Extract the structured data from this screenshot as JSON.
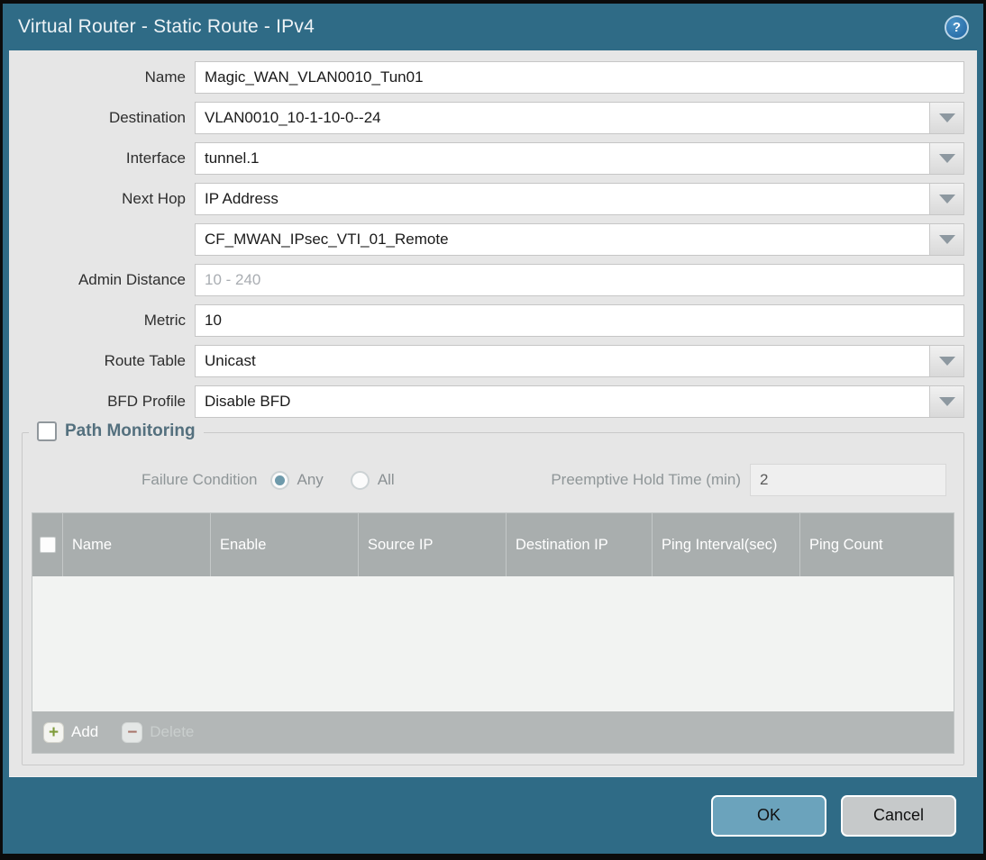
{
  "dialog": {
    "title": "Virtual Router - Static Route - IPv4"
  },
  "icons": {
    "help": "?",
    "dropdown": "triangle-down",
    "add": "+",
    "delete": "−"
  },
  "form": {
    "name": {
      "label": "Name",
      "value": "Magic_WAN_VLAN0010_Tun01"
    },
    "destination": {
      "label": "Destination",
      "value": "VLAN0010_10-1-10-0--24"
    },
    "interface": {
      "label": "Interface",
      "value": "tunnel.1"
    },
    "next_hop": {
      "label": "Next Hop",
      "value": "IP Address"
    },
    "next_hop_address": {
      "value": "CF_MWAN_IPsec_VTI_01_Remote"
    },
    "admin_distance": {
      "label": "Admin Distance",
      "value": "",
      "placeholder": "10 - 240"
    },
    "metric": {
      "label": "Metric",
      "value": "10"
    },
    "route_table": {
      "label": "Route Table",
      "value": "Unicast"
    },
    "bfd_profile": {
      "label": "BFD Profile",
      "value": "Disable BFD"
    }
  },
  "path_monitoring": {
    "title": "Path Monitoring",
    "enabled": false,
    "failure_condition_label": "Failure Condition",
    "options": {
      "any": "Any",
      "all": "All",
      "selected": "Any"
    },
    "preemptive_hold_time": {
      "label": "Preemptive Hold Time (min)",
      "value": "2"
    },
    "table": {
      "columns": [
        "Name",
        "Enable",
        "Source IP",
        "Destination IP",
        "Ping Interval(sec)",
        "Ping Count"
      ],
      "rows": []
    },
    "toolbar": {
      "add_label": "Add",
      "delete_label": "Delete"
    }
  },
  "footer": {
    "ok_label": "OK",
    "cancel_label": "Cancel"
  },
  "colors": {
    "titlebar": "#2f6b86",
    "content_bg": "#e6e6e6",
    "table_header_bg": "#a9aeae",
    "table_footer_bg": "#b3b7b7",
    "ok_button_bg": "#6ba3bc",
    "cancel_button_bg": "#c6c9ca",
    "add_icon_green": "#7f9c3a",
    "delete_icon_red": "#a8766c",
    "radio_selected": "#6e9aab"
  }
}
